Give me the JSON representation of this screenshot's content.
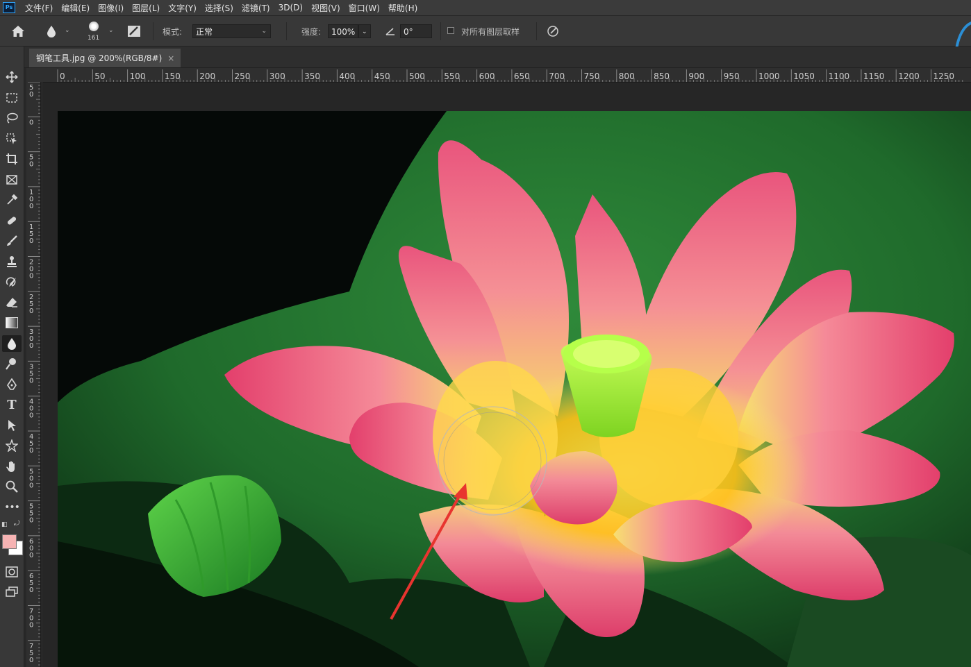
{
  "app": {
    "logo": "Ps"
  },
  "menu": [
    "文件(F)",
    "编辑(E)",
    "图像(I)",
    "图层(L)",
    "文字(Y)",
    "选择(S)",
    "滤镜(T)",
    "3D(D)",
    "视图(V)",
    "窗口(W)",
    "帮助(H)"
  ],
  "options": {
    "brush_size": "161",
    "mode_label": "模式:",
    "mode_value": "正常",
    "strength_label": "强度:",
    "strength_value": "100%",
    "angle_value": "0°",
    "sample_all_layers": "对所有图层取样"
  },
  "document_tab": {
    "title": "钢笔工具.jpg @ 200%(RGB/8#)",
    "close": "×"
  },
  "ruler": {
    "h_ticks": [
      "0",
      "50",
      "100",
      "150",
      "200",
      "250",
      "300",
      "350",
      "400",
      "450",
      "500",
      "550",
      "600",
      "650",
      "700",
      "750",
      "800",
      "850",
      "900",
      "950",
      "1000",
      "1050",
      "1100",
      "1150",
      "1200",
      "1250"
    ],
    "v_ticks": [
      "5\n0",
      "0",
      "5\n0",
      "1\n0\n0",
      "1\n5\n0",
      "2\n0\n0",
      "2\n5\n0",
      "3\n0\n0",
      "3\n5\n0",
      "4\n0\n0",
      "4\n5\n0",
      "5\n0\n0",
      "5\n5\n0",
      "6\n0\n0",
      "6\n5\n0",
      "7\n0\n0",
      "7\n5\n0"
    ]
  },
  "colors": {
    "foreground": "#f6b3b3",
    "background": "#ffffff",
    "accent": "#31a8ff",
    "arrow": "#e8342f"
  },
  "tools": [
    "move-icon",
    "marquee-icon",
    "lasso-icon",
    "object-select-icon",
    "crop-icon",
    "frame-icon",
    "eyedropper-icon",
    "healing-icon",
    "brush-icon",
    "stamp-icon",
    "history-brush-icon",
    "eraser-icon",
    "gradient-icon",
    "blur-icon",
    "dodge-icon",
    "pen-icon",
    "type-icon",
    "path-select-icon",
    "shape-icon",
    "hand-icon",
    "zoom-icon",
    "more-icon"
  ]
}
